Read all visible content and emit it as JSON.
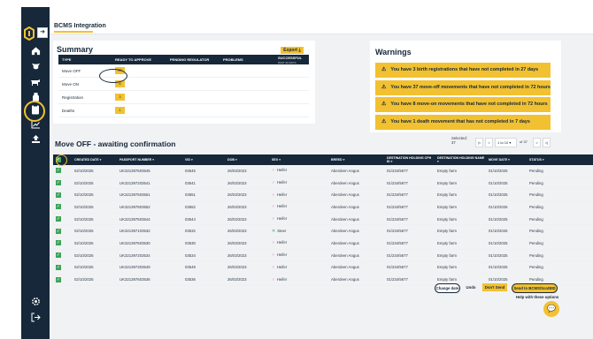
{
  "app": {
    "tab_label": "BCMS Integration"
  },
  "sidebar": {
    "icons": [
      "logo-icon",
      "home-icon",
      "cow-head-icon",
      "cattle-icon",
      "milk-can-icon",
      "clipboard-icon",
      "chart-icon",
      "upload-icon",
      "settings-icon",
      "logout-icon"
    ]
  },
  "summary": {
    "title": "Summary",
    "export_label": "Export",
    "headers": [
      "TYPE",
      "READY TO APPROVE",
      "PENDING REGULATOR",
      "PROBLEMS",
      "SUCCESSFUL"
    ],
    "successful_sub": "PAST 30 DAYS",
    "rows": [
      {
        "type": "Move OFF",
        "ready": "37"
      },
      {
        "type": "Move ON",
        "ready": "8"
      },
      {
        "type": "Registration",
        "ready": "3"
      },
      {
        "type": "Deaths",
        "ready": "1"
      }
    ]
  },
  "warnings": {
    "title": "Warnings",
    "items": [
      "You have 3 birth registrations that have not completed in 27 days",
      "You have 37 move-off movements that have not completed in 72 hours",
      "You have 8 move-on movements that have not completed in 72 hours",
      "You have 1 death movement that has not completed in 7 days"
    ]
  },
  "moveoff": {
    "title": "Move OFF - awaiting confirmation",
    "selected_label": "Selected:",
    "selected_count": "37",
    "pagination": {
      "first": "|<",
      "prev": "<",
      "range": "1 to 10",
      "of": "of 37",
      "next": ">",
      "last": ">|"
    },
    "headers": [
      "",
      "CREATED DATE",
      "PASSPORT NUMBER",
      "VID",
      "DOB",
      "SEX",
      "BREED",
      "DESTINATION HOLDING CPH ID",
      "DESTINATION HOLDING NAME",
      "MOVE DATE",
      "STATUS"
    ],
    "rows": [
      {
        "created": "02/10/2025",
        "passport": "UK321397603545",
        "vid": "03545",
        "dob": "26/03/2023",
        "sex": "Heifer",
        "breed": "Aberdeen Angus",
        "cph": "01/234/5677",
        "name": "Empty farm",
        "move": "01/10/2025",
        "status": "Pending"
      },
      {
        "created": "02/10/2025",
        "passport": "UK321397203541",
        "vid": "03541",
        "dob": "26/03/2023",
        "sex": "Heifer",
        "breed": "Aberdeen Angus",
        "cph": "01/234/5677",
        "name": "Empty farm",
        "move": "01/10/2025",
        "status": "Pending"
      },
      {
        "created": "02/10/2025",
        "passport": "UK321397503551",
        "vid": "03551",
        "dob": "26/03/2023",
        "sex": "Heifer",
        "breed": "Aberdeen Angus",
        "cph": "01/234/5677",
        "name": "Empty farm",
        "move": "01/10/2025",
        "status": "Pending"
      },
      {
        "created": "02/10/2025",
        "passport": "UK321397803552",
        "vid": "03552",
        "dob": "26/03/2023",
        "sex": "Heifer",
        "breed": "Aberdeen Angus",
        "cph": "01/234/5677",
        "name": "Empty farm",
        "move": "01/10/2025",
        "status": "Pending"
      },
      {
        "created": "02/10/2025",
        "passport": "UK321397503544",
        "vid": "03544",
        "dob": "26/03/2023",
        "sex": "Heifer",
        "breed": "Aberdeen Angus",
        "cph": "01/234/5677",
        "name": "Empty farm",
        "move": "01/10/2025",
        "status": "Pending"
      },
      {
        "created": "02/10/2025",
        "passport": "UK321397103532",
        "vid": "03532",
        "dob": "26/03/2023",
        "sex": "Steer",
        "breed": "Aberdeen Angus",
        "cph": "01/234/5677",
        "name": "Empty farm",
        "move": "01/10/2025",
        "status": "Pending"
      },
      {
        "created": "02/10/2025",
        "passport": "UK321397603530",
        "vid": "03530",
        "dob": "26/03/2023",
        "sex": "Heifer",
        "breed": "Aberdeen Angus",
        "cph": "01/234/5677",
        "name": "Empty farm",
        "move": "01/10/2025",
        "status": "Pending"
      },
      {
        "created": "02/10/2025",
        "passport": "UK321397203534",
        "vid": "03534",
        "dob": "26/03/2023",
        "sex": "Heifer",
        "breed": "Aberdeen Angus",
        "cph": "01/234/5677",
        "name": "Empty farm",
        "move": "01/10/2025",
        "status": "Pending"
      },
      {
        "created": "02/10/2025",
        "passport": "UK321397303549",
        "vid": "03549",
        "dob": "26/03/2023",
        "sex": "Heifer",
        "breed": "Aberdeen Angus",
        "cph": "01/234/5677",
        "name": "Empty farm",
        "move": "01/10/2025",
        "status": "Pending"
      },
      {
        "created": "02/10/2025",
        "passport": "UK321397603536",
        "vid": "03536",
        "dob": "26/03/2023",
        "sex": "Heifer",
        "breed": "Aberdeen Angus",
        "cph": "01/234/5677",
        "name": "Empty farm",
        "move": "01/10/2025",
        "status": "Pending"
      }
    ]
  },
  "footer": {
    "change_date": "Change date",
    "undo": "Undo",
    "dont_send": "Don't Send",
    "send": "Send to BCMS/ScotEID",
    "help": "Help with these options"
  },
  "colors": {
    "navy": "#16283a",
    "yellow": "#f2c131",
    "green": "#3da45a",
    "heifer": "#e46aa0",
    "steer": "#3da45a"
  }
}
